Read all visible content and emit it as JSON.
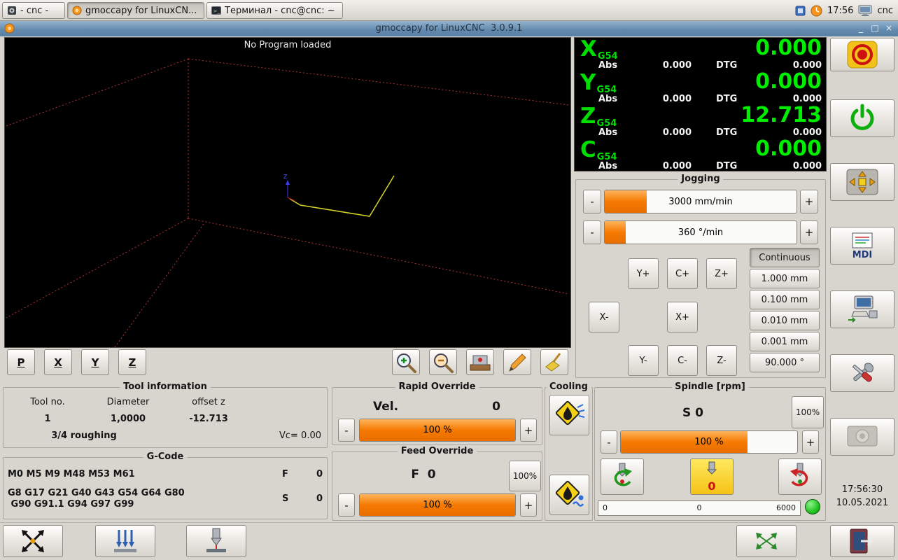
{
  "colors": {
    "accent_orange": "#f57900",
    "dro_green": "#00ee00",
    "dro_background": "#000000",
    "titlebar_blue": "#6289ad",
    "led_green": "#21c421",
    "estop_yellow": "#f2c21a",
    "estop_red": "#cc1111"
  },
  "window_controls": {
    "minimize": "_",
    "maximize": "□",
    "close": "×"
  },
  "controls": {
    "minus": "-",
    "plus": "+"
  },
  "taskbar": {
    "windows": [
      "- cnc -",
      "gmoccapy for LinuxCN...",
      "Терминал - cnc@cnc: ~"
    ],
    "time": "17:56",
    "user": "cnc"
  },
  "titlebar": {
    "title": "gmoccapy for LinuxCNC  3.0.9.1"
  },
  "preview": {
    "message": "No Program loaded",
    "axis_buttons": [
      "P",
      "X",
      "Y",
      "Z"
    ]
  },
  "dro": {
    "abs_label": "Abs",
    "dtg_label": "DTG",
    "axes": [
      {
        "letter": "X",
        "offset_system": "G54",
        "value": "0.000",
        "abs": "0.000",
        "dtg": "0.000"
      },
      {
        "letter": "Y",
        "offset_system": "G54",
        "value": "0.000",
        "abs": "0.000",
        "dtg": "0.000"
      },
      {
        "letter": "Z",
        "offset_system": "G54",
        "value": "12.713",
        "abs": "0.000",
        "dtg": "0.000"
      },
      {
        "letter": "C",
        "offset_system": "G54",
        "value": "0.000",
        "abs": "0.000",
        "dtg": "0.000"
      }
    ]
  },
  "jogging": {
    "title": "Jogging",
    "linear_rate": "3000 mm/min",
    "angular_rate": "360 °/min",
    "fills": {
      "linear": 22,
      "angular": 11
    },
    "buttons": [
      "Y+",
      "C+",
      "Z+",
      "X-",
      "X+",
      "Y-",
      "C-",
      "Z-"
    ],
    "increments": [
      "Continuous",
      "1.000 mm",
      "0.100 mm",
      "0.010 mm",
      "0.001 mm",
      "90.000 °"
    ],
    "active_increment": "Continuous"
  },
  "tool_info": {
    "title": "Tool information",
    "headers": {
      "tool_no": "Tool no.",
      "diameter": "Diameter",
      "offset_z": "offset z"
    },
    "tool_no": "1",
    "diameter": "1,0000",
    "offset_z": "-12.713",
    "description": "3/4 roughing",
    "vc": "Vc= 0.00"
  },
  "gcode": {
    "title": "G-Code",
    "m_codes": "M0 M5 M9 M48 M53 M61",
    "g_codes_line1": "G8 G17 G21 G40 G43 G54 G64 G80",
    "g_codes_line2": " G90 G91.1 G94 G97 G99",
    "f_label": "F",
    "f_value": "0",
    "s_label": "S",
    "s_value": "0"
  },
  "rapid_override": {
    "title": "Rapid Override",
    "vel_label": "Vel.",
    "vel_value": "0",
    "slider_text": "100 %",
    "fill": 100
  },
  "feed_override": {
    "title": "Feed Override",
    "value_label": "F  0",
    "reset_label": "100%",
    "slider_text": "100 %",
    "fill": 100
  },
  "cooling": {
    "title": "Cooling"
  },
  "spindle": {
    "title": "Spindle [rpm]",
    "value_label": "S 0",
    "reset_label": "100%",
    "slider_text": "100 %",
    "fill": 72,
    "stop_label": "0",
    "scale_min": "0",
    "scale_mid": "0",
    "scale_max": "6000"
  },
  "clock": {
    "time": "17:56:30",
    "date": "10.05.2021"
  },
  "mdi": {
    "label": "MDI"
  }
}
